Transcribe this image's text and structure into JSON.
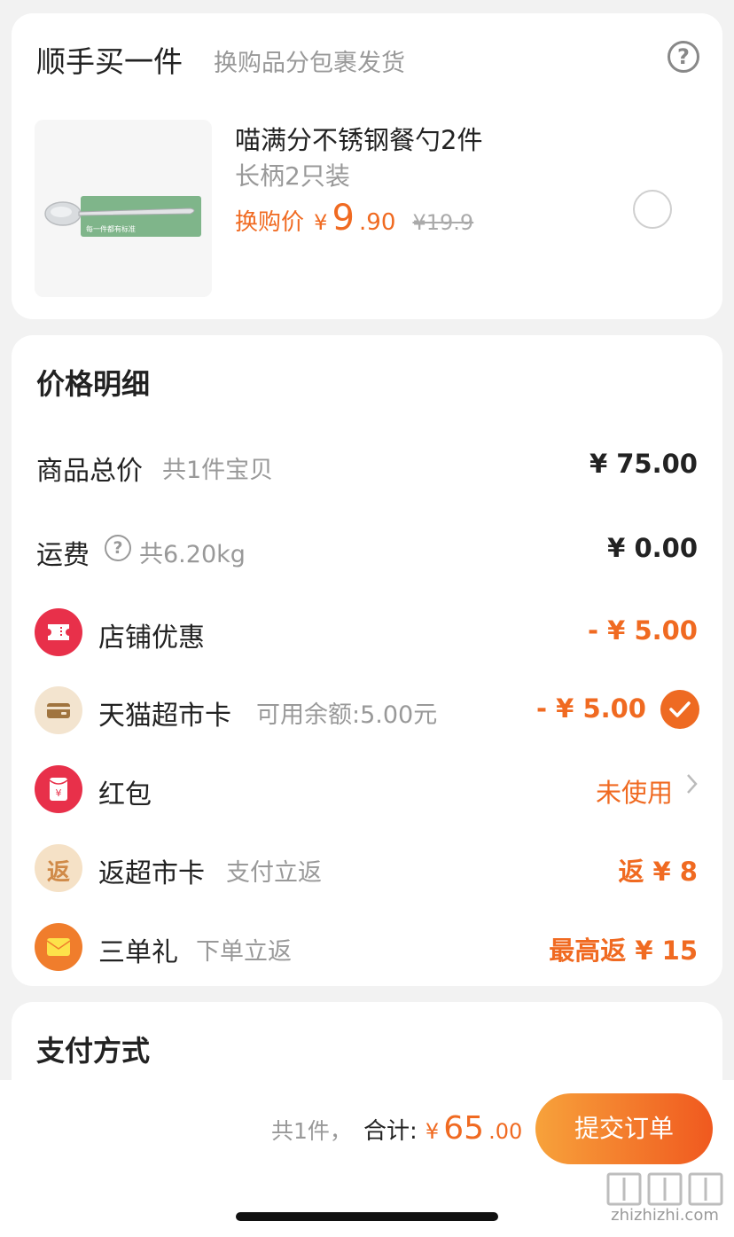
{
  "addon": {
    "title": "顺手买一件",
    "subtitle": "换购品分包裹发货",
    "help_icon": "question-circle-icon",
    "product": {
      "name": "喵满分不锈钢餐勺2件",
      "spec": "长柄2只装",
      "price_label": "换购价",
      "currency": "¥",
      "price_int": "9",
      "price_dec": ".90",
      "original_price": "¥19.9",
      "image_caption": "每一件都有标准",
      "selected": false
    }
  },
  "price_detail": {
    "title": "价格明细",
    "rows": [
      {
        "label": "商品总价",
        "sub": "共1件宝贝",
        "value": "¥ 75.00"
      },
      {
        "label": "运费",
        "sub": "共6.20kg",
        "value": "¥ 0.00"
      },
      {
        "label": "店铺优惠",
        "value": "- ¥ 5.00",
        "icon": "coupon-icon"
      },
      {
        "label": "天猫超市卡",
        "sub": "可用余额:5.00元",
        "value": "- ¥ 5.00",
        "icon": "card-icon",
        "checked": true
      },
      {
        "label": "红包",
        "value": "未使用",
        "icon": "red-packet-icon"
      },
      {
        "label": "返超市卡",
        "sub": "支付立返",
        "value": "返 ¥ 8",
        "icon": "rebate-icon",
        "icon_text": "返"
      },
      {
        "label": "三单礼",
        "sub": "下单立返",
        "value": "最高返 ¥ 15",
        "icon": "envelope-icon"
      }
    ]
  },
  "payment": {
    "title": "支付方式"
  },
  "bottom_bar": {
    "count": "共1件，",
    "total_label": "合计:",
    "currency": "¥",
    "total_int": "65",
    "total_dec": ".00",
    "submit_label": "提交订单"
  },
  "watermark": {
    "text": "zhizhizhi.com"
  },
  "colors": {
    "accent": "#f06a21",
    "muted": "#999999",
    "card": "#ffffff",
    "page_bg": "#f2f2f2"
  }
}
